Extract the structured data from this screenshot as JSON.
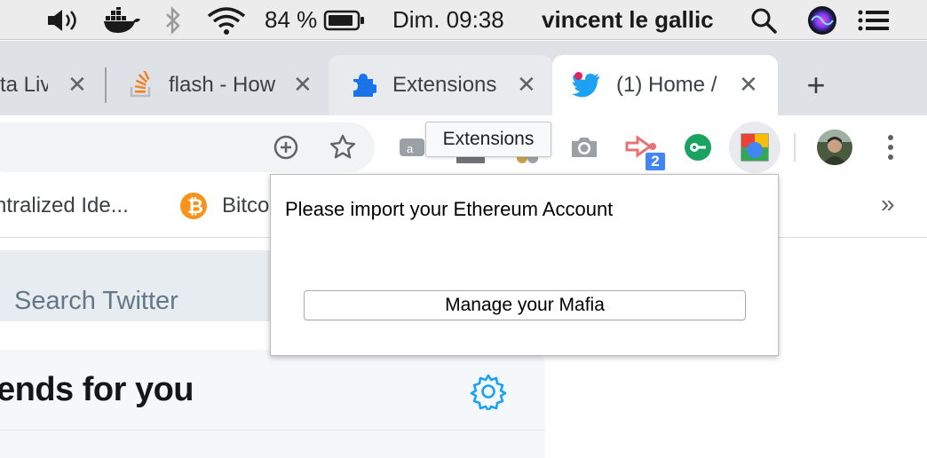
{
  "menubar": {
    "battery_percent": "84 %",
    "clock": "Dim. 09:38",
    "user_name": "vincent le gallic",
    "icons": [
      "volume-icon",
      "docker-icon",
      "bluetooth-icon",
      "wifi-icon",
      "battery-icon",
      "spotlight-search-icon",
      "siri-icon",
      "menu-extras-icon"
    ]
  },
  "tabs": [
    {
      "title": "ta Liv",
      "icon": "generic-page-icon",
      "state": "inactive"
    },
    {
      "title": "flash - How",
      "icon": "stackoverflow-icon",
      "state": "inactive"
    },
    {
      "title": "Extensions",
      "icon": "puzzle-icon",
      "state": "hovered"
    },
    {
      "title": "(1) Home /",
      "icon": "twitter-bird-icon",
      "state": "active",
      "has_notification_dot": true
    }
  ],
  "new_tab_label": "+",
  "toolbar": {
    "extension_badge": "2",
    "tooltip": "Extensions",
    "icons": [
      "zoom-icon",
      "bookmark-star-icon",
      "camera-extension-icon",
      "flow-extension-icon",
      "green-key-extension-icon",
      "mafia-extension-icon",
      "profile-avatar",
      "more-menu-icon"
    ]
  },
  "bookmarks": {
    "items": [
      {
        "label": "ntralized Ide...",
        "icon": null
      },
      {
        "label": "Bitco",
        "icon": "bitcoin-icon"
      }
    ],
    "overflow": "»"
  },
  "twitter": {
    "search_placeholder": "Search Twitter",
    "trends_title": "ends for you"
  },
  "popup": {
    "message": "Please import your Ethereum Account",
    "button_label": "Manage your Mafia"
  },
  "colors": {
    "twitter_blue": "#1da1f2",
    "chrome_blue": "#1a73e8",
    "badge_blue": "#4285f4",
    "bitcoin_orange": "#f7931a"
  }
}
